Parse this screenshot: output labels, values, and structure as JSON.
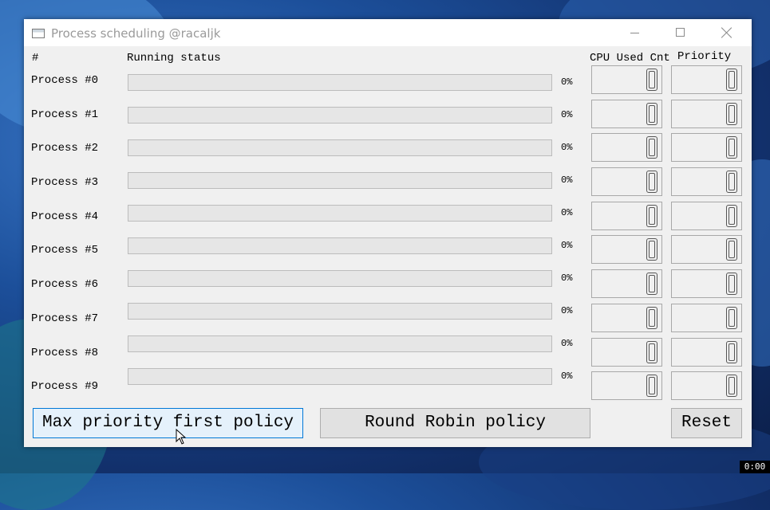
{
  "window": {
    "title": "Process scheduling @racaljk"
  },
  "headers": {
    "index": "#",
    "status": "Running status",
    "cpu": "CPU Used Cnt",
    "priority": "Priority"
  },
  "processes": [
    {
      "label": "Process #0",
      "progress_percent": 0,
      "progress_text": "0%",
      "cpu_used": "0",
      "priority": "0"
    },
    {
      "label": "Process #1",
      "progress_percent": 0,
      "progress_text": "0%",
      "cpu_used": "0",
      "priority": "0"
    },
    {
      "label": "Process #2",
      "progress_percent": 0,
      "progress_text": "0%",
      "cpu_used": "0",
      "priority": "0"
    },
    {
      "label": "Process #3",
      "progress_percent": 0,
      "progress_text": "0%",
      "cpu_used": "0",
      "priority": "0"
    },
    {
      "label": "Process #4",
      "progress_percent": 0,
      "progress_text": "0%",
      "cpu_used": "0",
      "priority": "0"
    },
    {
      "label": "Process #5",
      "progress_percent": 0,
      "progress_text": "0%",
      "cpu_used": "0",
      "priority": "0"
    },
    {
      "label": "Process #6",
      "progress_percent": 0,
      "progress_text": "0%",
      "cpu_used": "0",
      "priority": "0"
    },
    {
      "label": "Process #7",
      "progress_percent": 0,
      "progress_text": "0%",
      "cpu_used": "0",
      "priority": "0"
    },
    {
      "label": "Process #8",
      "progress_percent": 0,
      "progress_text": "0%",
      "cpu_used": "0",
      "priority": "0"
    },
    {
      "label": "Process #9",
      "progress_percent": 0,
      "progress_text": "0%",
      "cpu_used": "0",
      "priority": "0"
    }
  ],
  "buttons": {
    "max_priority": "Max priority first policy",
    "round_robin": "Round Robin policy",
    "reset": "Reset"
  },
  "recorder": {
    "time": "0:00"
  },
  "colors": {
    "progress_fill": "#06b025",
    "focus_border": "#0078d7"
  },
  "icons": {
    "app": "app-window-icon",
    "minimize": "minimize-icon",
    "maximize": "maximize-icon",
    "close": "close-icon",
    "cursor": "mouse-cursor-icon"
  }
}
